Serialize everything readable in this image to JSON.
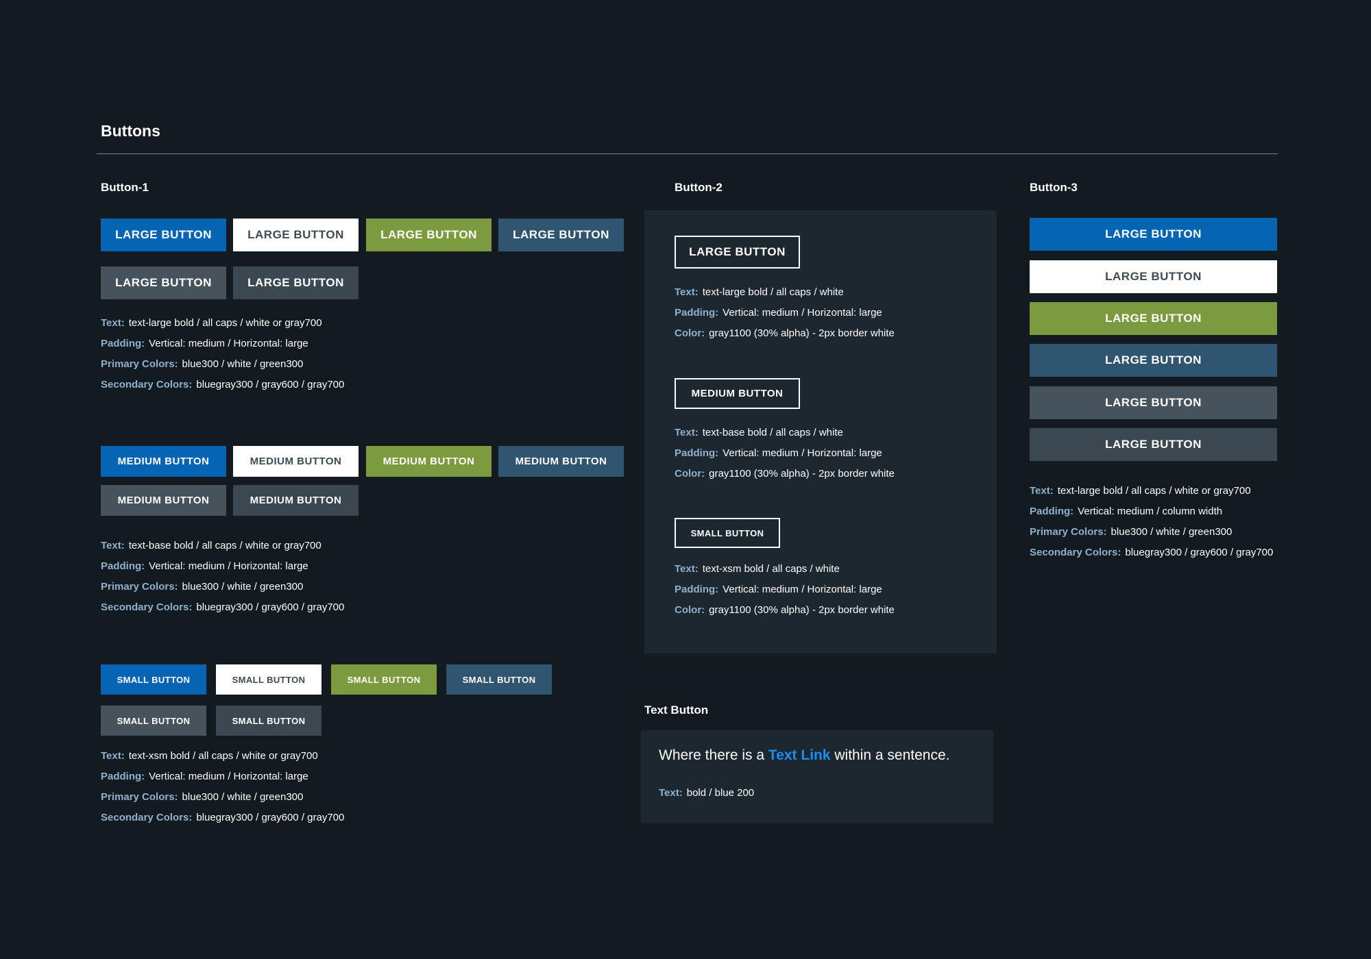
{
  "page_title": "Buttons",
  "labels": {
    "text": "Text:",
    "padding": "Padding:",
    "color": "Color:",
    "primary": "Primary Colors:",
    "secondary": "Secondary Colors:"
  },
  "colors": {
    "blue300": "#0565b4",
    "white": "#ffffff",
    "green300": "#7b9b3e",
    "bluegray300": "#2f5570",
    "gray600": "#46535d",
    "gray700": "#3b4852",
    "link_blue200": "#1c8ef0",
    "background": "#131a20",
    "panel": "#1d272f"
  },
  "button1": {
    "title": "Button-1",
    "large": {
      "label": "LARGE BUTTON",
      "spec": {
        "text": "text-large bold / all caps / white or gray700",
        "padding": "Vertical: medium  / Horizontal: large",
        "primary": "blue300 / white / green300",
        "secondary": "bluegray300 / gray600 / gray700"
      }
    },
    "medium": {
      "label": "MEDIUM BUTTON",
      "spec": {
        "text": "text-base bold / all caps / white or gray700",
        "padding": "Vertical: medium  / Horizontal: large",
        "primary": "blue300 / white / green300",
        "secondary": "bluegray300 / gray600 / gray700"
      }
    },
    "small": {
      "label": "SMALL BUTTON",
      "spec": {
        "text": "text-xsm bold / all caps / white or gray700",
        "padding": "Vertical: medium  / Horizontal: large",
        "primary": "blue300 / white / green300",
        "secondary": "bluegray300 / gray600 / gray700"
      }
    }
  },
  "button2": {
    "title": "Button-2",
    "large": {
      "label": "LARGE BUTTON",
      "spec": {
        "text": "text-large bold / all caps / white",
        "padding": "Vertical: medium  / Horizontal: large",
        "color": "gray1100  (30% alpha) - 2px border white"
      }
    },
    "medium": {
      "label": "MEDIUM BUTTON",
      "spec": {
        "text": "text-base bold / all caps / white",
        "padding": "Vertical: medium  / Horizontal: large",
        "color": "gray1100  (30% alpha) - 2px border white"
      }
    },
    "small": {
      "label": "SMALL BUTTON",
      "spec": {
        "text": "text-xsm bold / all caps / white",
        "padding": "Vertical: medium  / Horizontal: large",
        "color": "gray1100  (30% alpha) - 2px border white"
      }
    }
  },
  "button3": {
    "title": "Button-3",
    "label": "LARGE BUTTON",
    "spec": {
      "text": "text-large bold / all caps / white or gray700",
      "padding": "Vertical: medium / column width",
      "primary": "blue300 / white / green300",
      "secondary": "bluegray300 / gray600 / gray700"
    }
  },
  "text_button": {
    "title": "Text Button",
    "sentence_before": "Where there is a",
    "link_text": "Text Link",
    "sentence_after": "within a sentence.",
    "spec_text": "bold / blue 200"
  }
}
